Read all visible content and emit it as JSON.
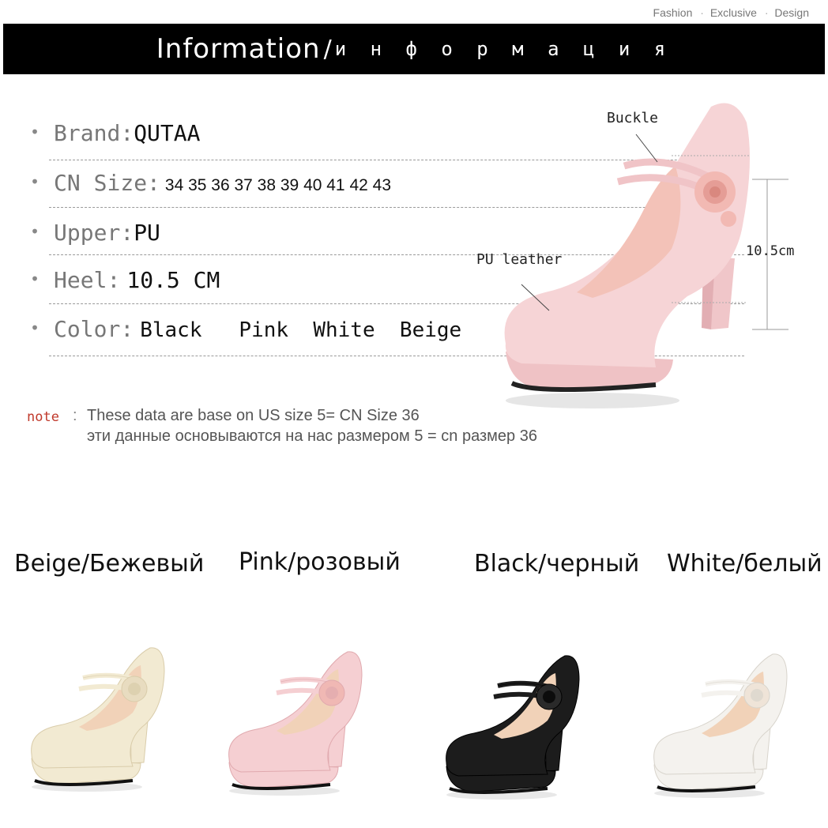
{
  "tagline": [
    "Fashion",
    "Exclusive",
    "Design"
  ],
  "banner": {
    "title": "Information",
    "subtitle": "и н ф о р м а ц и я"
  },
  "info": {
    "brand": {
      "label": "Brand:",
      "value": "QUTAA"
    },
    "size": {
      "label": "CN Size:",
      "value": "34 35 36 37 38 39 40 41 42 43"
    },
    "upper": {
      "label": "Upper: ",
      "value": "PU"
    },
    "heel": {
      "label": "Heel: ",
      "value": "10.5 CM"
    },
    "color": {
      "label": "Color:",
      "value": "Black   Pink  White  Beige"
    }
  },
  "note": {
    "tag": "note",
    "line1": "These data are base on US size 5= CN Size 36",
    "line2": "эти данные основываются на нас размером 5 = cn размер 36"
  },
  "callouts": {
    "buckle": "Buckle",
    "material": "PU leather",
    "heel_height": "10.5cm"
  },
  "variants": [
    {
      "label": "Beige/Бежевый",
      "color": "#f2ead2",
      "shade": "#d9ccaa",
      "flower": "#e8dcc0"
    },
    {
      "label": "Pink/розовый",
      "color": "#f5cfd2",
      "shade": "#e0a9ae",
      "flower": "#f0b8b4"
    },
    {
      "label": "Black/черный",
      "color": "#1c1c1c",
      "shade": "#000000",
      "flower": "#2a2a2a"
    },
    {
      "label": "White/белый",
      "color": "#f4f2ee",
      "shade": "#d8d4cc",
      "flower": "#efe4d8"
    }
  ],
  "colors": {
    "main_shoe": "#f6d4d6",
    "banner": "#000000",
    "note_tag": "#c0392b"
  }
}
